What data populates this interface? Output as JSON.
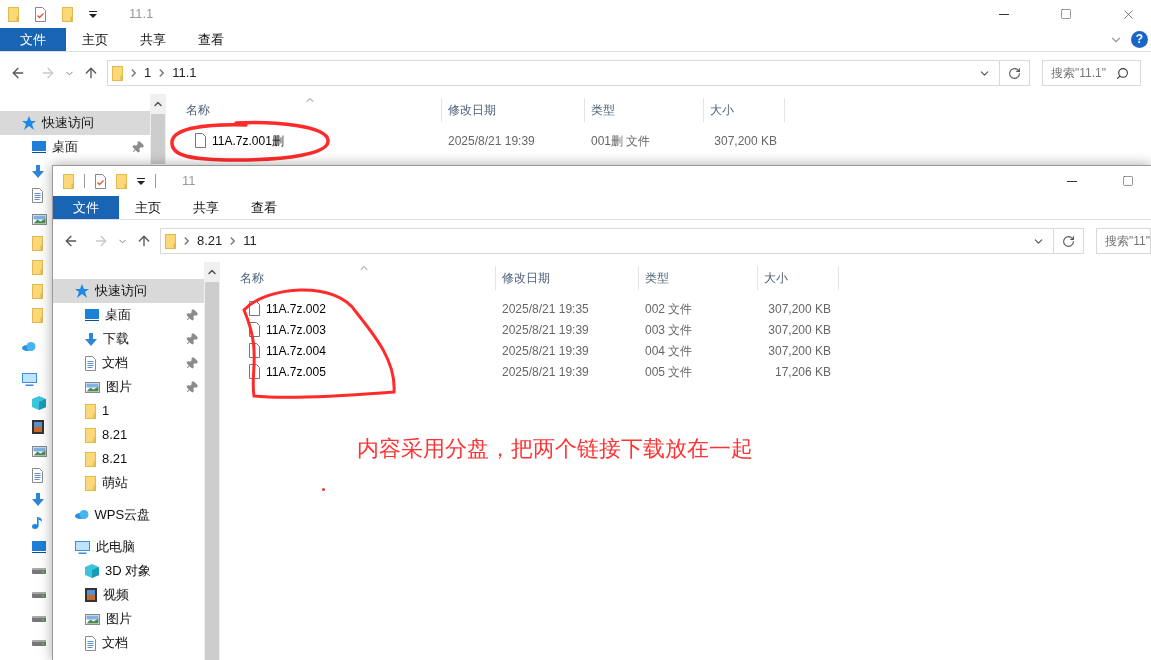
{
  "back_window": {
    "title": "11.1",
    "ribbon_tabs": [
      {
        "label": "文件",
        "selected": true
      },
      {
        "label": "主页",
        "selected": false
      },
      {
        "label": "共享",
        "selected": false
      },
      {
        "label": "查看",
        "selected": false
      }
    ],
    "ribbon_help": "?",
    "path": [
      "1",
      "11.1"
    ],
    "search": {
      "placeholder": "搜索\"11.1\""
    },
    "sidebar": [
      {
        "label": "快速访问",
        "kind": "star",
        "selected": true,
        "children": [
          {
            "label": "桌面",
            "kind": "desktop",
            "pinned": true,
            "selected": false
          },
          {
            "kind": "download",
            "selected": false
          },
          {
            "kind": "doc",
            "selected": false
          },
          {
            "kind": "picture",
            "selected": false
          },
          {
            "kind": "folder",
            "selected": false
          },
          {
            "kind": "folder",
            "selected": false
          },
          {
            "kind": "folder",
            "selected": false
          },
          {
            "kind": "folder",
            "selected": false
          }
        ]
      },
      {
        "kind": "cloud",
        "selected": false
      },
      {
        "kind": "pc",
        "selected": false,
        "children": [
          {
            "kind": "cube",
            "selected": false
          },
          {
            "kind": "video",
            "selected": false
          },
          {
            "kind": "picture",
            "selected": false
          },
          {
            "kind": "doc",
            "selected": false
          },
          {
            "kind": "download",
            "selected": false
          },
          {
            "kind": "music",
            "selected": false
          },
          {
            "kind": "desktop",
            "selected": false
          },
          {
            "kind": "drive",
            "selected": false
          },
          {
            "kind": "drive",
            "selected": false
          },
          {
            "kind": "drive",
            "selected": false
          },
          {
            "kind": "drive",
            "selected": false
          }
        ]
      }
    ],
    "columns": [
      "名称",
      "修改日期",
      "类型",
      "大小"
    ],
    "files": [
      {
        "name": "11A.7z.001删",
        "modified": "2025/8/21 19:39",
        "type": "001删 文件",
        "size": "307,200 KB"
      }
    ]
  },
  "front_window": {
    "title": "11",
    "ribbon_tabs": [
      {
        "label": "文件",
        "selected": true
      },
      {
        "label": "主页",
        "selected": false
      },
      {
        "label": "共享",
        "selected": false
      },
      {
        "label": "查看",
        "selected": false
      }
    ],
    "path": [
      "8.21",
      "11"
    ],
    "search": {
      "placeholder": "搜索\"11\""
    },
    "sidebar": [
      {
        "label": "快速访问",
        "kind": "star",
        "selected": true,
        "children": [
          {
            "label": "桌面",
            "kind": "desktop",
            "pinned": true,
            "selected": false
          },
          {
            "label": "下载",
            "kind": "download",
            "pinned": true,
            "selected": false
          },
          {
            "label": "文档",
            "kind": "doc",
            "pinned": true,
            "selected": false
          },
          {
            "label": "图片",
            "kind": "picture",
            "pinned": true,
            "selected": false
          },
          {
            "label": "1",
            "kind": "folder",
            "pinned": false,
            "selected": false
          },
          {
            "label": "8.21",
            "kind": "folder",
            "pinned": false,
            "selected": false
          },
          {
            "label": "8.21",
            "kind": "folder",
            "pinned": false,
            "selected": false
          },
          {
            "label": "萌站",
            "kind": "folder",
            "pinned": false,
            "selected": false
          }
        ]
      },
      {
        "label": "WPS云盘",
        "kind": "cloud",
        "selected": false
      },
      {
        "label": "此电脑",
        "kind": "pc",
        "selected": false,
        "children": [
          {
            "label": "3D 对象",
            "kind": "cube",
            "selected": false
          },
          {
            "label": "视频",
            "kind": "video",
            "selected": false
          },
          {
            "label": "图片",
            "kind": "picture",
            "selected": false
          },
          {
            "label": "文档",
            "kind": "doc",
            "selected": false
          }
        ]
      }
    ],
    "columns": [
      "名称",
      "修改日期",
      "类型",
      "大小"
    ],
    "files": [
      {
        "name": "11A.7z.002",
        "modified": "2025/8/21 19:35",
        "type": "002 文件",
        "size": "307,200 KB"
      },
      {
        "name": "11A.7z.003",
        "modified": "2025/8/21 19:39",
        "type": "003 文件",
        "size": "307,200 KB"
      },
      {
        "name": "11A.7z.004",
        "modified": "2025/8/21 19:39",
        "type": "004 文件",
        "size": "307,200 KB"
      },
      {
        "name": "11A.7z.005",
        "modified": "2025/8/21 19:39",
        "type": "005 文件",
        "size": "17,206 KB"
      }
    ]
  },
  "annotation": {
    "note": "内容采用分盘，把两个链接下载放在一起"
  }
}
